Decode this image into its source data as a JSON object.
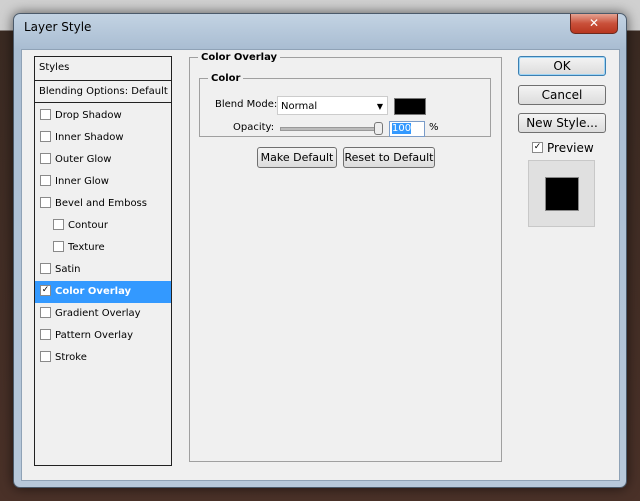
{
  "window": {
    "title": "Layer Style",
    "close": "✕"
  },
  "sidebar": {
    "header": "Styles",
    "blending": "Blending Options: Default",
    "items": [
      {
        "label": "Drop Shadow",
        "checked": false,
        "indent": false
      },
      {
        "label": "Inner Shadow",
        "checked": false,
        "indent": false
      },
      {
        "label": "Outer Glow",
        "checked": false,
        "indent": false
      },
      {
        "label": "Inner Glow",
        "checked": false,
        "indent": false
      },
      {
        "label": "Bevel and Emboss",
        "checked": false,
        "indent": false
      },
      {
        "label": "Contour",
        "checked": false,
        "indent": true
      },
      {
        "label": "Texture",
        "checked": false,
        "indent": true
      },
      {
        "label": "Satin",
        "checked": false,
        "indent": false
      },
      {
        "label": "Color Overlay",
        "checked": true,
        "indent": false,
        "selected": true
      },
      {
        "label": "Gradient Overlay",
        "checked": false,
        "indent": false
      },
      {
        "label": "Pattern Overlay",
        "checked": false,
        "indent": false
      },
      {
        "label": "Stroke",
        "checked": false,
        "indent": false
      }
    ]
  },
  "panel": {
    "title": "Color Overlay",
    "group": "Color",
    "blend_label": "Blend Mode:",
    "blend_value": "Normal",
    "overlay_color": "#000000",
    "opacity_label": "Opacity:",
    "opacity_value": "100",
    "opacity_unit": "%",
    "opacity_fraction": 1.0,
    "make_default": "Make Default",
    "reset_default": "Reset to Default"
  },
  "buttons": {
    "ok": "OK",
    "cancel": "Cancel",
    "new_style": "New Style...",
    "preview": "Preview",
    "preview_checked": true
  }
}
